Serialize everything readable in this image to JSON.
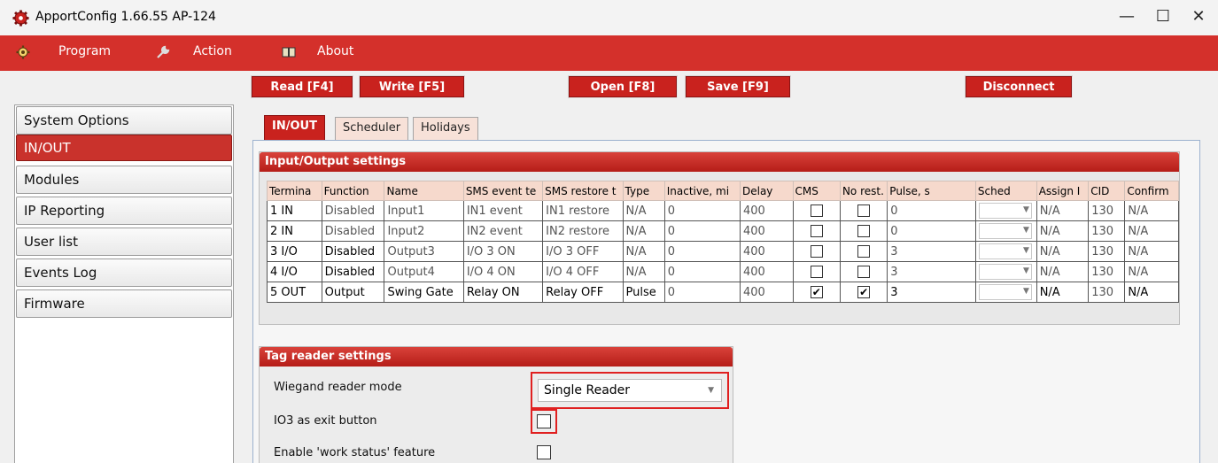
{
  "window": {
    "title": "ApportConfig 1.66.55   AP-124",
    "minimize": "—",
    "maximize": "☐",
    "close": "✕"
  },
  "menu": {
    "program": "Program",
    "action": "Action",
    "about": "About"
  },
  "toolbar": {
    "read": "Read [F4]",
    "write": "Write [F5]",
    "open": "Open [F8]",
    "save": "Save [F9]",
    "disconnect": "Disconnect"
  },
  "sidebar": {
    "items": [
      {
        "label": "System Options",
        "active": false
      },
      {
        "label": "IN/OUT",
        "active": true
      },
      {
        "label": "Modules",
        "active": false
      },
      {
        "label": "IP Reporting",
        "active": false
      },
      {
        "label": "User list",
        "active": false
      },
      {
        "label": "Events Log",
        "active": false
      },
      {
        "label": "Firmware",
        "active": false
      }
    ]
  },
  "tabs": [
    {
      "label": "IN/OUT",
      "active": true
    },
    {
      "label": "Scheduler",
      "active": false
    },
    {
      "label": "Holidays",
      "active": false
    }
  ],
  "io_settings": {
    "title": "Input/Output settings",
    "columns": [
      "Termina",
      "Function",
      "Name",
      "SMS event te",
      "SMS restore t",
      "Type",
      "Inactive, mi",
      "Delay",
      "CMS",
      "No rest.",
      "Pulse, s",
      "Sched",
      "Assign I",
      "CID",
      "Confirm"
    ],
    "rows": [
      {
        "terminal": "1 IN",
        "function": "Disabled",
        "name": "Input1",
        "sms_event": "IN1 event",
        "sms_restore": "IN1 restore",
        "type": "N/A",
        "inactive": "0",
        "delay": "400",
        "cms": false,
        "no_restore": false,
        "pulse": "0",
        "assign": "N/A",
        "cid": "130",
        "confirm": "N/A"
      },
      {
        "terminal": "2 IN",
        "function": "Disabled",
        "name": "Input2",
        "sms_event": "IN2 event",
        "sms_restore": "IN2 restore",
        "type": "N/A",
        "inactive": "0",
        "delay": "400",
        "cms": false,
        "no_restore": false,
        "pulse": "0",
        "assign": "N/A",
        "cid": "130",
        "confirm": "N/A"
      },
      {
        "terminal": "3 I/O",
        "function": "Disabled",
        "name": "Output3",
        "sms_event": "I/O 3 ON",
        "sms_restore": "I/O 3 OFF",
        "type": "N/A",
        "inactive": "0",
        "delay": "400",
        "cms": false,
        "no_restore": false,
        "pulse": "3",
        "assign": "N/A",
        "cid": "130",
        "confirm": "N/A"
      },
      {
        "terminal": "4 I/O",
        "function": "Disabled",
        "name": "Output4",
        "sms_event": "I/O 4 ON",
        "sms_restore": "I/O 4 OFF",
        "type": "N/A",
        "inactive": "0",
        "delay": "400",
        "cms": false,
        "no_restore": false,
        "pulse": "3",
        "assign": "N/A",
        "cid": "130",
        "confirm": "N/A"
      },
      {
        "terminal": "5 OUT",
        "function": "Output",
        "name": "Swing Gate",
        "sms_event": "Relay ON",
        "sms_restore": "Relay OFF",
        "type": "Pulse",
        "inactive": "0",
        "delay": "400",
        "cms": true,
        "no_restore": true,
        "pulse": "3",
        "assign": "N/A",
        "cid": "130",
        "confirm": "N/A"
      }
    ]
  },
  "tag_reader": {
    "title": "Tag reader settings",
    "wiegand_label": "Wiegand reader mode",
    "wiegand_value": "Single Reader",
    "io3_exit_label": "IO3 as exit button",
    "io3_exit_checked": false,
    "work_status_label": "Enable 'work status' feature",
    "work_status_checked": false
  },
  "colors": {
    "accent": "#d4302b",
    "highlight": "#e02020"
  }
}
